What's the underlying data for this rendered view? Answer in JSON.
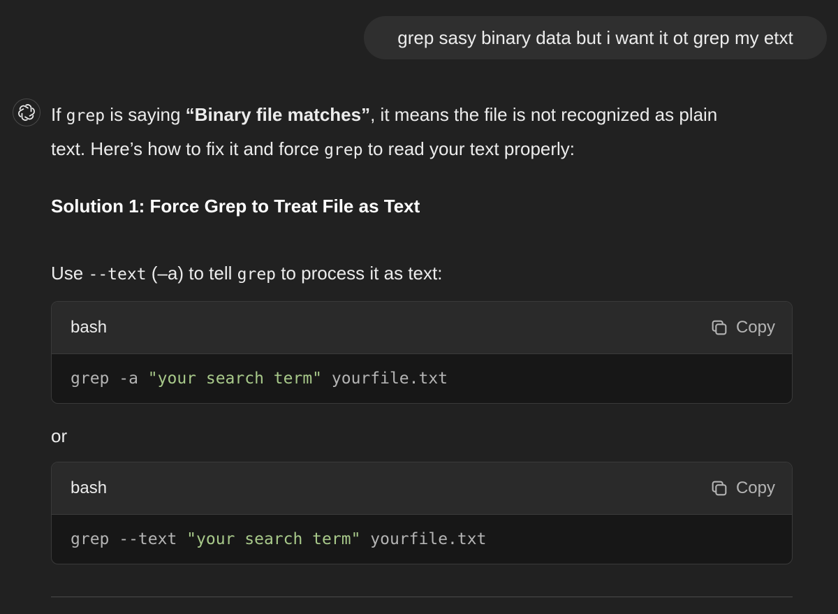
{
  "user_message": "grep sasy binary data but i want it ot grep my etxt",
  "assistant": {
    "intro": {
      "p1_a": "If ",
      "p1_code": "grep",
      "p1_b": " is saying ",
      "p1_bold": "“Binary file matches”",
      "p1_c": ", it means the file is not recognized as plain",
      "p2_a": "text. Here’s how to fix it and force ",
      "p2_code": "grep",
      "p2_b": " to read your text properly:"
    },
    "heading": "Solution 1: Force Grep to Treat File as Text",
    "use_line": {
      "a": "Use ",
      "code1": "--text",
      "b": " (–a) to tell ",
      "code2": "grep",
      "c": " to process it as text:"
    },
    "code_blocks": [
      {
        "lang": "bash",
        "copy_label": "Copy",
        "cmd": "grep -a ",
        "str": "\"your search term\"",
        "rest": " yourfile.txt"
      },
      {
        "lang": "bash",
        "copy_label": "Copy",
        "cmd": "grep --text ",
        "str": "\"your search term\"",
        "rest": " yourfile.txt"
      }
    ],
    "or_text": "or"
  },
  "icons": {
    "avatar": "openai-logo-icon",
    "copy": "copy-icon"
  },
  "colors": {
    "background": "#212121",
    "bubble": "#2f2f2f",
    "code_header": "#2a2a2a",
    "code_body": "#171717",
    "string": "#a8c98a"
  }
}
